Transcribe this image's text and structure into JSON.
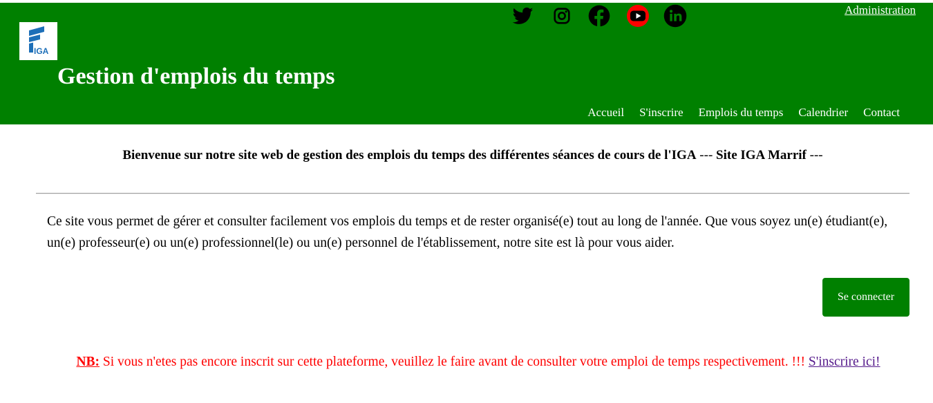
{
  "header": {
    "logo_text": "IGA",
    "title": "Gestion d'emplois du temps",
    "admin_link": "Administration",
    "social": [
      "twitter-icon",
      "instagram-icon",
      "facebook-icon",
      "youtube-icon",
      "linkedin-icon"
    ],
    "nav": [
      {
        "label": "Accueil"
      },
      {
        "label": "S'inscrire"
      },
      {
        "label": "Emplois du temps"
      },
      {
        "label": "Calendrier"
      },
      {
        "label": "Contact"
      }
    ]
  },
  "main": {
    "welcome_bold_1": "Bienvenue sur notre site web de gestion des emplois du temps des différentes séances de cours de l'IGA",
    "welcome_sep_1": " --- ",
    "welcome_bold_2": "Site IGA Marrif",
    "welcome_sep_2": " ---",
    "intro": "Ce site vous permet de gérer et consulter facilement vos emplois du temps et de rester organisé(e) tout au long de l'année. Que vous soyez un(e) étudiant(e), un(e) professeur(e) ou un(e) professionnel(le) ou un(e) personnel de l'établissement, notre site est là pour vous aider.",
    "connect_button": "Se connecter",
    "nb_label": "NB:",
    "nb_text": " Si vous n'etes pas encore inscrit sur cette plateforme, veuillez le faire avant de consulter votre emploi de temps respectivement. !!! ",
    "nb_link": "S'inscrire ici!"
  },
  "colors": {
    "header_bg": "#008000",
    "button_bg": "#008000",
    "nb_text": "#ff0000",
    "link_visited": "#551a8b"
  }
}
